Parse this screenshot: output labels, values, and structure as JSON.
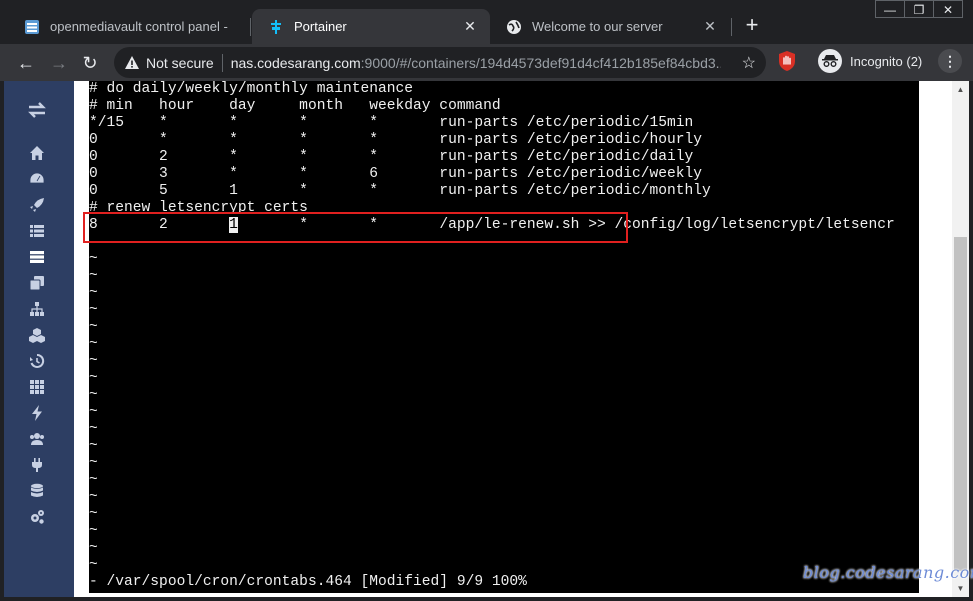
{
  "tabs": [
    {
      "title": "openmediavault control panel - ",
      "icon": "omv-icon",
      "active": false
    },
    {
      "title": "Portainer",
      "icon": "portainer-icon",
      "active": true
    },
    {
      "title": "Welcome to our server",
      "icon": "globe-icon",
      "active": false
    }
  ],
  "toolbar": {
    "security_label": "Not secure",
    "url_host": "nas.codesarang.com",
    "url_rest": ":9000/#/containers/194d4573def91d4cf412b185ef84cbd3...",
    "incognito_label": "Incognito (2)"
  },
  "sidebar_icons": [
    "swap-icon",
    "home-icon",
    "dashboard-icon",
    "rocket-icon",
    "list-icon",
    "server-icon",
    "copy-icon",
    "sitemap-icon",
    "cubes-icon",
    "history-icon",
    "grid-icon",
    "bolt-icon",
    "users-icon",
    "plug-icon",
    "database-icon",
    "cogs-icon"
  ],
  "terminal": {
    "lines": [
      "# do daily/weekly/monthly maintenance",
      "# min   hour    day     month   weekday command",
      "*/15    *       *       *       *       run-parts /etc/periodic/15min",
      "0       *       *       *       *       run-parts /etc/periodic/hourly",
      "0       2       *       *       *       run-parts /etc/periodic/daily",
      "0       3       *       *       6       run-parts /etc/periodic/weekly",
      "0       5       1       *       *       run-parts /etc/periodic/monthly",
      "# renew letsencrypt certs"
    ],
    "edit_line": {
      "before_cursor": "8       2       ",
      "cursor_char": "1",
      "after_cursor": "       *       *       /app/le-renew.sh >> /config/log/letsencrypt/letsencr"
    },
    "tilde": "~",
    "tilde_count": 19,
    "status_line": "- /var/spool/cron/crontabs.464 [Modified] 9/9 100%"
  },
  "watermark": "blog.codesarang.com",
  "colors": {
    "chrome_bg": "#202124",
    "toolbar_bg": "#35363a",
    "sidebar_bg": "#2d3e63",
    "terminal_bg": "#000000",
    "terminal_fg": "#f0f0f0",
    "highlight": "#e0201f"
  }
}
